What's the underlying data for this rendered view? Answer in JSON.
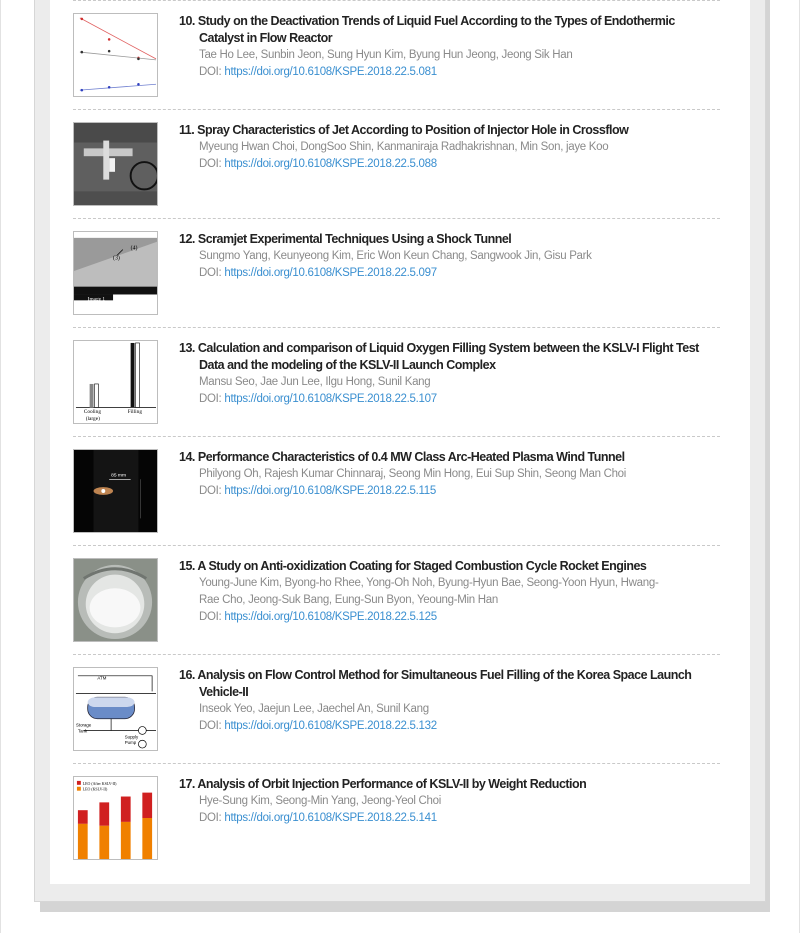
{
  "articles": [
    {
      "number": "10.",
      "title": "Study on the Deactivation Trends of Liquid Fuel According to the Types of Endothermic Catalyst in Flow Reactor",
      "authors": "Tae Ho Lee, Sunbin Jeon, Sung Hyun Kim, Byung Hun Jeong, Jeong Sik Han",
      "doi_label": "DOI:",
      "doi": "https://doi.org/10.6108/KSPE.2018.22.5.081"
    },
    {
      "number": "11.",
      "title": "Spray Characteristics of Jet According to Position of Injector Hole in Crossflow",
      "authors": "Myeung Hwan Choi, DongSoo Shin, Kanmaniraja Radhakrishnan, Min Son, jaye Koo",
      "doi_label": "DOI:",
      "doi": "https://doi.org/10.6108/KSPE.2018.22.5.088"
    },
    {
      "number": "12.",
      "title": "Scramjet Experimental Techniques Using a Shock Tunnel",
      "authors": "Sungmo Yang, Keunyeong Kim, Eric Won Keun Chang, Sangwook Jin, Gisu Park",
      "doi_label": "DOI:",
      "doi": "https://doi.org/10.6108/KSPE.2018.22.5.097",
      "thumb_text": [
        "(3)",
        "(4)",
        "Image 1"
      ]
    },
    {
      "number": "13.",
      "title": "Calculation and comparison of Liquid Oxygen Filling System between the KSLV-I Flight Test Data and the modeling of the KSLV-II Launch Complex",
      "authors": "Mansu Seo, Jae Jun Lee, Ilgu Hong, Sunil Kang",
      "doi_label": "DOI:",
      "doi": "https://doi.org/10.6108/KSPE.2018.22.5.107",
      "thumb_text": [
        "Cooling",
        "(large)",
        "Filling"
      ]
    },
    {
      "number": "14.",
      "title": "Performance Characteristics of 0.4 MW Class Arc-Heated Plasma Wind Tunnel",
      "authors": "Philyong Oh, Rajesh Kumar Chinnaraj, Seong Min Hong, Eui Sup Shin, Seong Man Choi",
      "doi_label": "DOI:",
      "doi": "https://doi.org/10.6108/KSPE.2018.22.5.115",
      "thumb_text": [
        "85 mm"
      ]
    },
    {
      "number": "15.",
      "title": "A Study on Anti-oxidization Coating for Staged Combustion Cycle Rocket Engines",
      "authors": "Young-June Kim, Byong-ho Rhee, Yong-Oh Noh, Byung-Hyun Bae, Seong-Yoon Hyun, Hwang-Rae Cho, Jeong-Suk Bang, Eung-Sun Byon, Yeoung-Min Han",
      "doi_label": "DOI:",
      "doi": "https://doi.org/10.6108/KSPE.2018.22.5.125"
    },
    {
      "number": "16.",
      "title": "Analysis on Flow Control Method for Simultaneous Fuel Filling of the Korea Space Launch Vehicle-II",
      "authors": "Inseok Yeo, Jaejun Lee, Jaechel An, Sunil Kang",
      "doi_label": "DOI:",
      "doi": "https://doi.org/10.6108/KSPE.2018.22.5.132",
      "thumb_text": [
        "ATM",
        "Storage",
        "Tank",
        "Supply",
        "Pump"
      ]
    },
    {
      "number": "17.",
      "title": "Analysis of Orbit Injection Performance of KSLV-II by Weight Reduction",
      "authors": "Hye-Sung Kim, Seong-Min Yang, Jeong-Yeol Choi",
      "doi_label": "DOI:",
      "doi": "https://doi.org/10.6108/KSPE.2018.22.5.141",
      "thumb_text": [
        "LEO (After KSLV-II)",
        "LEO (KSLV-II)"
      ]
    }
  ],
  "colors": {
    "link": "#3a8fd0",
    "title": "#222222",
    "meta": "#8a8a8a"
  }
}
